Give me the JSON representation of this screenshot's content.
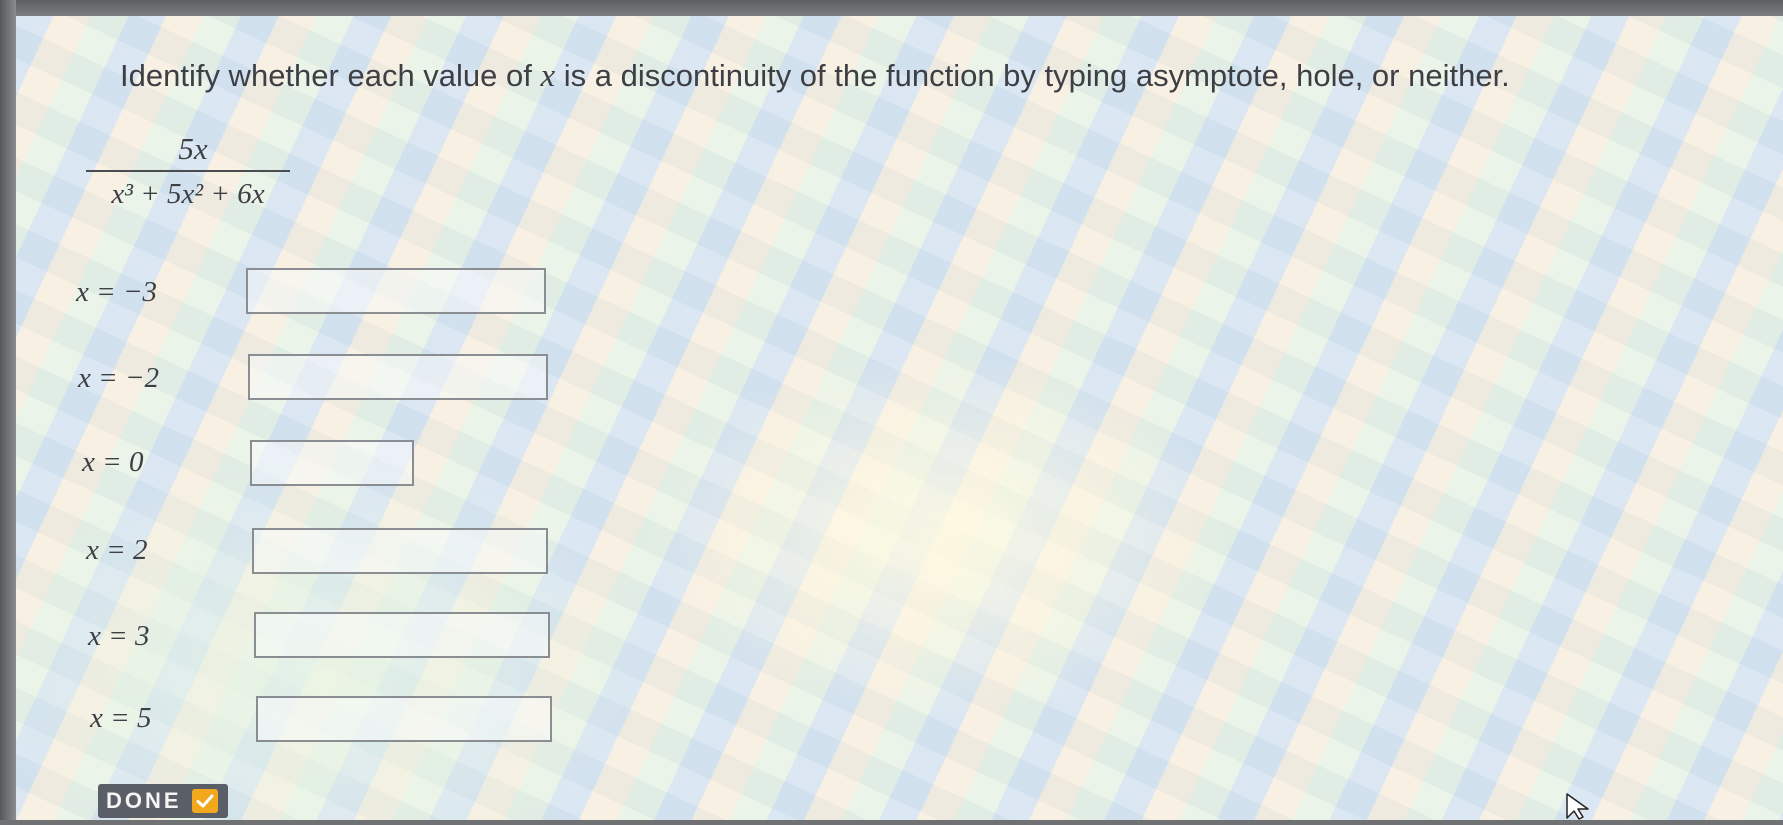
{
  "prompt": {
    "before_var": "Identify whether each value of ",
    "var": "x",
    "after_var": " is a discontinuity of the function by typing asymptote, hole, or neither."
  },
  "function": {
    "numerator": "5x",
    "denominator": "x³ + 5x² + 6x"
  },
  "rows": [
    {
      "label": "x = −3",
      "value": ""
    },
    {
      "label": "x = −2",
      "value": ""
    },
    {
      "label": "x = 0",
      "value": ""
    },
    {
      "label": "x = 2",
      "value": ""
    },
    {
      "label": "x = 3",
      "value": ""
    },
    {
      "label": "x = 5",
      "value": ""
    }
  ],
  "done_button": {
    "label": "DONE",
    "icon": "check-icon"
  },
  "colors": {
    "text": "#3d3f44",
    "done_background": "#5a5e66",
    "check_accent": "#f2a81d",
    "box_border": "#8a8d92"
  }
}
